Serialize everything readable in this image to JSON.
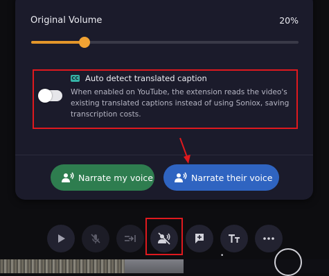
{
  "volume": {
    "label": "Original Volume",
    "value_text": "20%",
    "level": 0.2
  },
  "option": {
    "title": "Auto detect translated caption",
    "description": "When enabled on YouTube, the extension reads the video's existing translated captions instead of using Soniox, saving transcription costs.",
    "enabled": false
  },
  "buttons": {
    "narrate_mine": "Narrate my voice",
    "narrate_theirs": "Narrate their voice"
  },
  "controls": [
    "play-icon",
    "mic-off-icon",
    "skip-to-icon",
    "voice-off-icon",
    "add-comment-icon",
    "text-size-icon",
    "more-icon"
  ],
  "colors": {
    "accent_orange": "#f0a233",
    "highlight_red": "#e0191e",
    "green_button": "#2e7d4f",
    "blue_button": "#2f64c1",
    "cc_teal": "#36b3a6"
  },
  "background_overlay": {
    "text": "•"
  }
}
